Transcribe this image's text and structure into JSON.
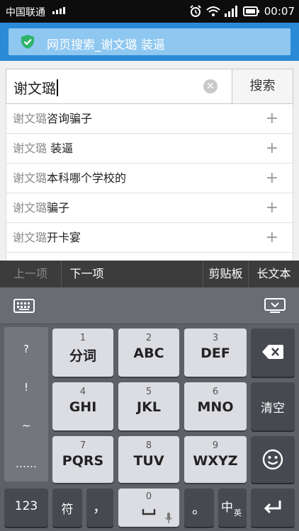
{
  "status": {
    "carrier": "中国联通",
    "time": "00:07"
  },
  "banner": {
    "text": "网页搜索_谢文璐 装逼"
  },
  "search": {
    "query": "谢文璐",
    "button_label": "搜索"
  },
  "suggestions": [
    {
      "query": "谢文璐",
      "rest": "咨询骗子"
    },
    {
      "query": "谢文璐",
      "rest": " 装逼"
    },
    {
      "query": "谢文璐",
      "rest": "本科哪个学校的"
    },
    {
      "query": "谢文璐",
      "rest": "骗子"
    },
    {
      "query": "谢文璐",
      "rest": "开卡宴"
    }
  ],
  "suggestion_add_symbol": "+",
  "toolbar": {
    "prev": "上一项",
    "next": "下一项",
    "clipboard": "剪贴板",
    "long_text": "长文本"
  },
  "keyboard": {
    "side_symbols": [
      "?",
      "!",
      "~",
      "……"
    ],
    "keys": [
      {
        "num": "1",
        "label": "分词"
      },
      {
        "num": "2",
        "label": "ABC"
      },
      {
        "num": "3",
        "label": "DEF"
      },
      {
        "num": "4",
        "label": "GHI"
      },
      {
        "num": "5",
        "label": "JKL"
      },
      {
        "num": "6",
        "label": "MNO"
      },
      {
        "num": "7",
        "label": "PQRS"
      },
      {
        "num": "8",
        "label": "TUV"
      },
      {
        "num": "9",
        "label": "WXYZ"
      }
    ],
    "clear": "清空",
    "num_switch": "123",
    "symbol": "符",
    "comma": "，",
    "space_num": "0",
    "period": "。",
    "lang_main": "中",
    "lang_sub": "英"
  },
  "colors": {
    "header": "#2a8ad6",
    "banner": "#8ec7f0",
    "shield": "#2fb36b",
    "keyboard_bg": "#5e6068"
  }
}
